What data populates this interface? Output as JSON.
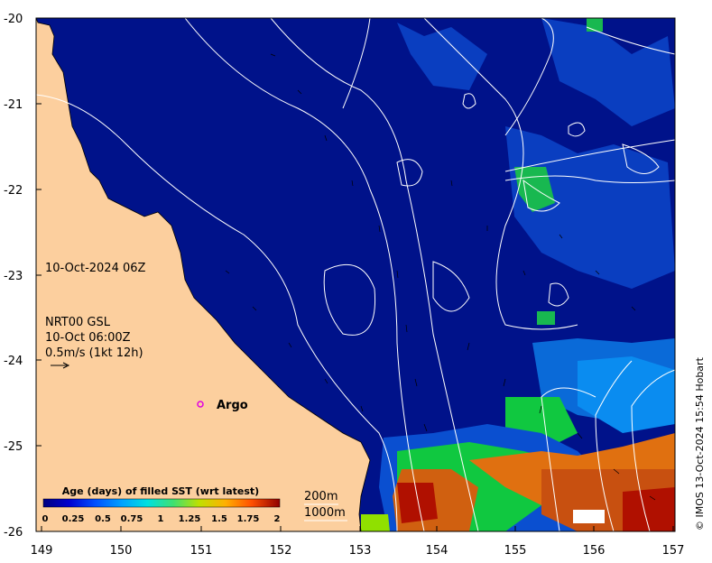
{
  "map": {
    "date_label": "10-Oct-2024 06Z",
    "current_label_1": "NRT00 GSL",
    "current_label_2": "10-Oct 06:00Z",
    "current_scale": "0.5m/s (1kt 12h)",
    "argo_label": "Argo",
    "colorbar_title": "Age (days) of filled SST (wrt latest)",
    "colorbar_ticks": [
      "0",
      "0.25",
      "0.5",
      "0.75",
      "1",
      "1.25",
      "1.5",
      "1.75",
      "2"
    ],
    "contour_label_1": "200m",
    "contour_label_2": "1000m",
    "credit": "© IMOS 13-Oct-2024 15:54 Hobart",
    "x_ticks": [
      "149",
      "150",
      "151",
      "152",
      "153",
      "154",
      "155",
      "156",
      "157"
    ],
    "y_ticks": [
      "-20",
      "-21",
      "-22",
      "-23",
      "-24",
      "-25",
      "-26"
    ],
    "colors": {
      "land": "#fccf9e",
      "ocean_age_0": "#00128a",
      "age_mid_blue": "#0a4fd0",
      "age_light_blue": "#0a8cf0",
      "age_green": "#10c840",
      "age_orange": "#e07010",
      "age_red": "#b01000",
      "argo_marker": "#e000e0"
    }
  }
}
